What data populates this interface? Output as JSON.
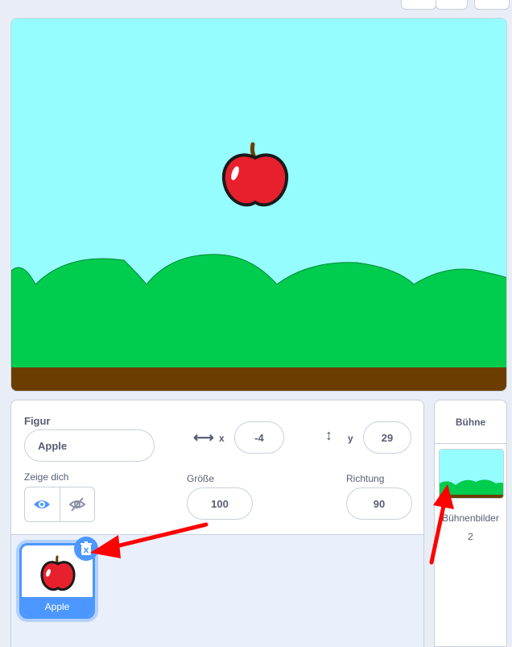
{
  "sprite_info": {
    "sprite_label": "Figur",
    "sprite_name": "Apple",
    "x_label": "x",
    "x_value": "-4",
    "y_label": "y",
    "y_value": "29",
    "show_label": "Zeige dich",
    "size_label": "Größe",
    "size_value": "100",
    "direction_label": "Richtung",
    "direction_value": "90"
  },
  "sprite_list": {
    "items": [
      {
        "name": "Apple"
      }
    ]
  },
  "stage_panel": {
    "title": "Bühne",
    "backdrops_label": "Bühnenbilder",
    "backdrops_count": "2"
  },
  "colors": {
    "sky": "#96fdff",
    "grass": "#00cc4e",
    "ground": "#6b3e00",
    "accent": "#4c97ff",
    "annotation": "#ff0000"
  }
}
